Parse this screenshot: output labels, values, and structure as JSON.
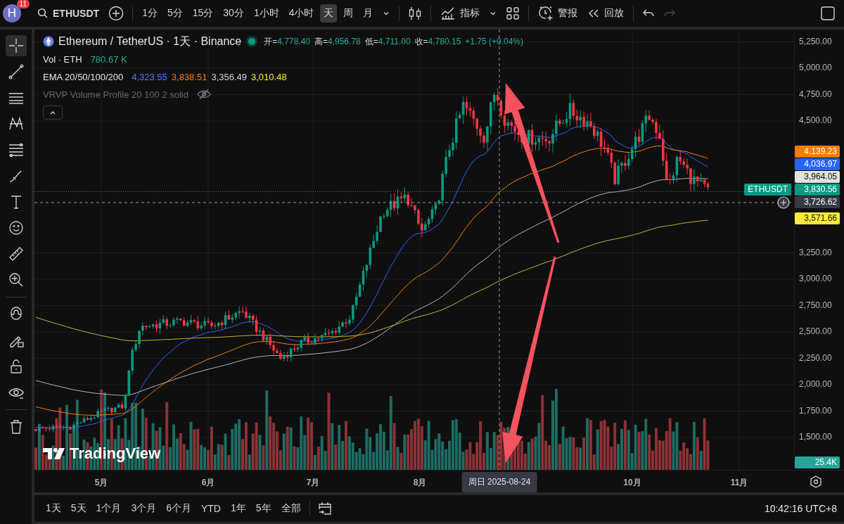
{
  "top_bar": {
    "avatar": "H",
    "notification_count": "11",
    "symbol": "ETHUSDT",
    "intervals": [
      {
        "label": "1分",
        "selected": false
      },
      {
        "label": "5分",
        "selected": false
      },
      {
        "label": "15分",
        "selected": false
      },
      {
        "label": "30分",
        "selected": false
      },
      {
        "label": "1小时",
        "selected": false
      },
      {
        "label": "4小时",
        "selected": false
      },
      {
        "label": "天",
        "selected": true
      },
      {
        "label": "周",
        "selected": false
      },
      {
        "label": "月",
        "selected": false
      }
    ],
    "indicators_label": "指标",
    "alert_label": "警报",
    "replay_label": "回放",
    "redo_disabled": true
  },
  "legend": {
    "title": "Ethereum / TetherUS · 1天 · Binance",
    "ohlc": [
      {
        "label": "开=",
        "value": "4,778.40"
      },
      {
        "label": "高=",
        "value": "4,956.78"
      },
      {
        "label": "低=",
        "value": "4,711.00"
      },
      {
        "label": "收=",
        "value": "4,780.15"
      }
    ],
    "change": "+1.75 (+0.04%)",
    "volume": {
      "label": "Vol · ETH",
      "value": "780.67 K"
    },
    "ema": {
      "label": "EMA 20/50/100/200",
      "values": [
        {
          "value": "4,323.55",
          "color": "#4a7dff"
        },
        {
          "value": "3,838.51",
          "color": "#f57c00"
        },
        {
          "value": "3,356.49",
          "color": "#d1d4dc"
        },
        {
          "value": "3,010.48",
          "color": "#ffeb3b"
        }
      ]
    },
    "vrvp": {
      "label": "VRVP Volume Profile 20 100 2 solid",
      "visible": false
    }
  },
  "drawing_tools": [
    {
      "kind": "crosshair",
      "selected": true
    },
    {
      "kind": "trend-line",
      "selected": false
    },
    {
      "kind": "horizontal-lines",
      "selected": false
    },
    {
      "kind": "pattern",
      "selected": false
    },
    {
      "kind": "fib",
      "selected": false
    },
    {
      "kind": "brush",
      "selected": false
    },
    {
      "kind": "text",
      "selected": false
    },
    {
      "kind": "emoji",
      "selected": false
    },
    {
      "kind": "ruler",
      "selected": false
    },
    {
      "kind": "zoom",
      "selected": false
    },
    {
      "kind": "magnet",
      "selected": false
    },
    {
      "kind": "lock-pencil",
      "selected": false
    },
    {
      "kind": "lock",
      "selected": false
    },
    {
      "kind": "eye",
      "selected": false
    },
    {
      "kind": "trash",
      "selected": false
    }
  ],
  "price_axis": {
    "ticks": [
      "5,250.00",
      "5,000.00",
      "4,750.00",
      "4,500.00",
      "3,250.00",
      "3,000.00",
      "2,750.00",
      "2,500.00",
      "2,250.00",
      "2,000.00",
      "1,750.00",
      "1,500.00"
    ],
    "labels": [
      {
        "kind": "line",
        "value": "4,139.23",
        "color": "#f57c00"
      },
      {
        "kind": "line",
        "value": "4,036.97",
        "color": "#2962ff"
      },
      {
        "kind": "line",
        "value": "3,964.05",
        "color": "#e0e0e0"
      },
      {
        "kind": "last",
        "symbol": "ETHUSDT",
        "value": "3,830.56",
        "color": "#089981"
      },
      {
        "kind": "crosshair",
        "value": "3,726.62",
        "color": "#363a45"
      },
      {
        "kind": "line",
        "value": "3,571.66",
        "color": "#ffeb3b"
      }
    ],
    "volume_label": "25.4K"
  },
  "time_axis": {
    "months": [
      "5月",
      "6月",
      "7月",
      "8月",
      "10月",
      "11月"
    ],
    "crosshair_date": "周日 2025-08-24"
  },
  "logo": "TradingView",
  "bottom_bar": {
    "ranges": [
      "1天",
      "5天",
      "1个月",
      "3个月",
      "6个月",
      "YTD",
      "1年",
      "5年",
      "全部"
    ],
    "clock": "10:42:16 UTC+8"
  }
}
